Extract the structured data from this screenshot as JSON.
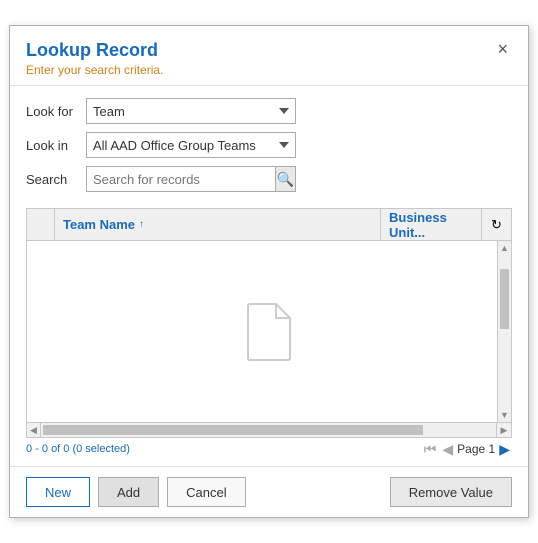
{
  "dialog": {
    "title": "Lookup Record",
    "subtitle": "Enter your search criteria.",
    "close_label": "×"
  },
  "form": {
    "look_for_label": "Look for",
    "look_in_label": "Look in",
    "search_label": "Search",
    "look_for_value": "Team",
    "look_in_value": "All AAD Office Group Teams",
    "search_placeholder": "Search for records",
    "look_for_options": [
      "Team"
    ],
    "look_in_options": [
      "All AAD Office Group Teams"
    ]
  },
  "grid": {
    "col_name": "Team Name",
    "col_name_sort": "↑",
    "col_business": "Business Unit...",
    "record_info": "0 - 0 of 0 (0 selected)"
  },
  "pagination": {
    "page_label": "Page 1"
  },
  "footer": {
    "new_label": "New",
    "add_label": "Add",
    "cancel_label": "Cancel",
    "remove_label": "Remove Value"
  }
}
